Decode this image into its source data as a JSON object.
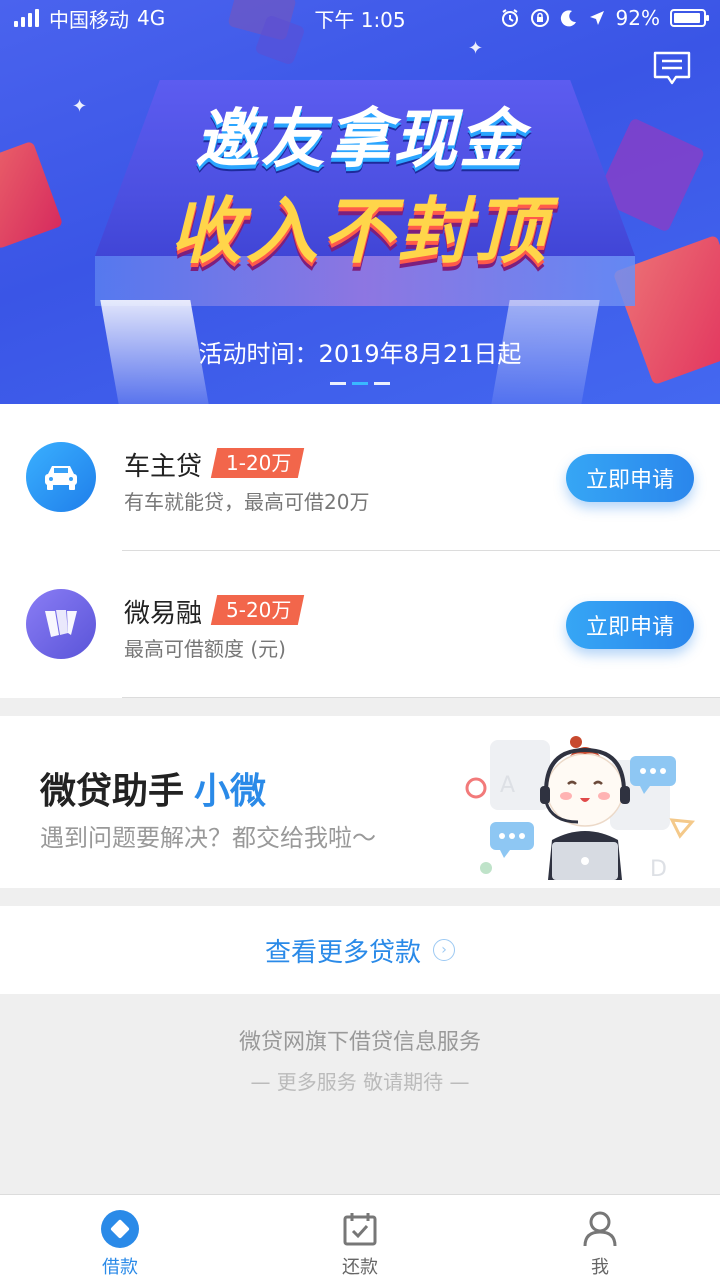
{
  "status_bar": {
    "carrier": "中国移动",
    "network": "4G",
    "time": "下午 1:05",
    "battery": "92%",
    "battery_level": 0.92
  },
  "banner": {
    "title_line1": "邀友拿现金",
    "title_line2": "收入不封顶",
    "activity_time": "活动时间：2019年8月21日起",
    "slide_count": 3,
    "active_slide": 1
  },
  "loans": [
    {
      "name": "车主贷",
      "tag": "1-20万",
      "description": "有车就能贷，最高可借20万",
      "button": "立即申请",
      "icon": "car-icon"
    },
    {
      "name": "微易融",
      "tag": "5-20万",
      "description": "最高可借额度 (元)",
      "button": "立即申请",
      "icon": "weiyirong-logo-icon"
    }
  ],
  "assistant": {
    "title": "微贷助手",
    "title_accent": "小微",
    "subtitle": "遇到问题要解决？都交给我啦～"
  },
  "more_loans": {
    "label": "查看更多贷款"
  },
  "footer": {
    "line1": "微贷网旗下借贷信息服务",
    "line2": "— 更多服务 敬请期待 —"
  },
  "tabbar": {
    "items": [
      {
        "label": "借款",
        "icon": "borrow-icon",
        "active": true
      },
      {
        "label": "还款",
        "icon": "repay-calendar-icon",
        "active": false
      },
      {
        "label": "我",
        "icon": "profile-icon",
        "active": false
      }
    ]
  },
  "colors": {
    "accent": "#2a8ae8",
    "tag": "#f2664b",
    "banner_blue": "#4a63ee"
  }
}
